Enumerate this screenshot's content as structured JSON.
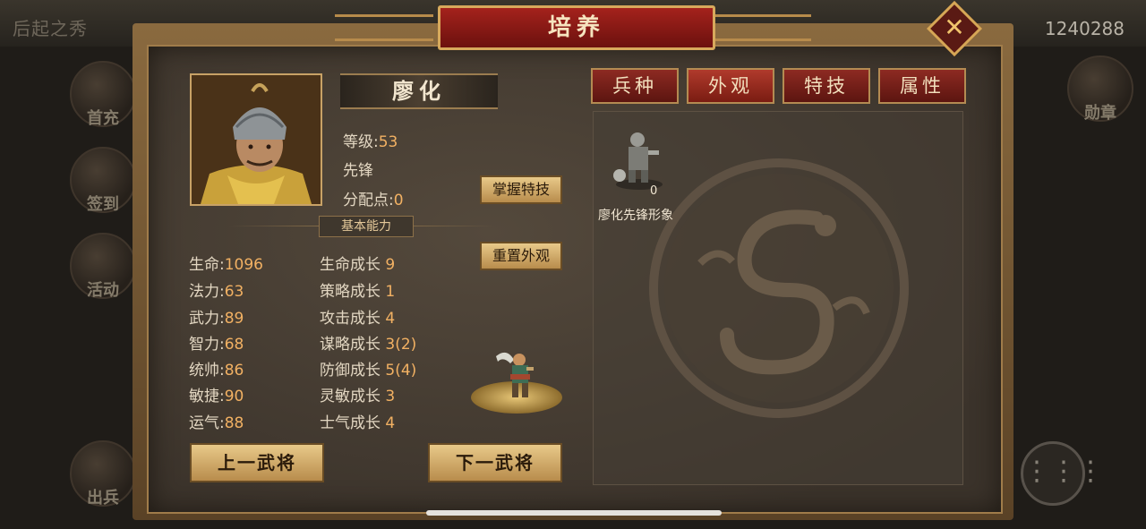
{
  "background": {
    "title": "后起之秀",
    "score": "1240288",
    "side_buttons": [
      "首充",
      "签到",
      "活动",
      "出兵"
    ],
    "right_button": "勋章",
    "menu_icon": "menu-icon"
  },
  "dialog": {
    "title": "培养",
    "close_icon": "close-icon"
  },
  "general": {
    "name": "廖化",
    "level_label": "等级:",
    "level": "53",
    "role": "先锋",
    "points_label": "分配点:",
    "points": "0"
  },
  "buttons": {
    "master_skill": "掌握特技",
    "reset_appearance": "重置外观",
    "prev_general": "上一武将",
    "next_general": "下一武将"
  },
  "section_title": "基本能力",
  "stats": [
    {
      "label": "生命:",
      "value": "1096"
    },
    {
      "label": "法力:",
      "value": "63"
    },
    {
      "label": "武力:",
      "value": "89"
    },
    {
      "label": "智力:",
      "value": "68"
    },
    {
      "label": "统帅:",
      "value": "86"
    },
    {
      "label": "敏捷:",
      "value": "90"
    },
    {
      "label": "运气:",
      "value": "88"
    }
  ],
  "growth": [
    {
      "label": "生命成长",
      "value": "9"
    },
    {
      "label": "策略成长",
      "value": "1"
    },
    {
      "label": "攻击成长",
      "value": "4"
    },
    {
      "label": "谋略成长",
      "value": "3(2)"
    },
    {
      "label": "防御成长",
      "value": "5(4)"
    },
    {
      "label": "灵敏成长",
      "value": "3"
    },
    {
      "label": "士气成长",
      "value": "4"
    }
  ],
  "tabs": [
    "兵种",
    "外观",
    "特技",
    "属性"
  ],
  "active_tab": 1,
  "appearance": {
    "count": "0",
    "label": "廖化先锋形象"
  },
  "colors": {
    "accent_red": "#8d2a22",
    "gold": "#d6a756",
    "value_orange": "#f2b163"
  }
}
